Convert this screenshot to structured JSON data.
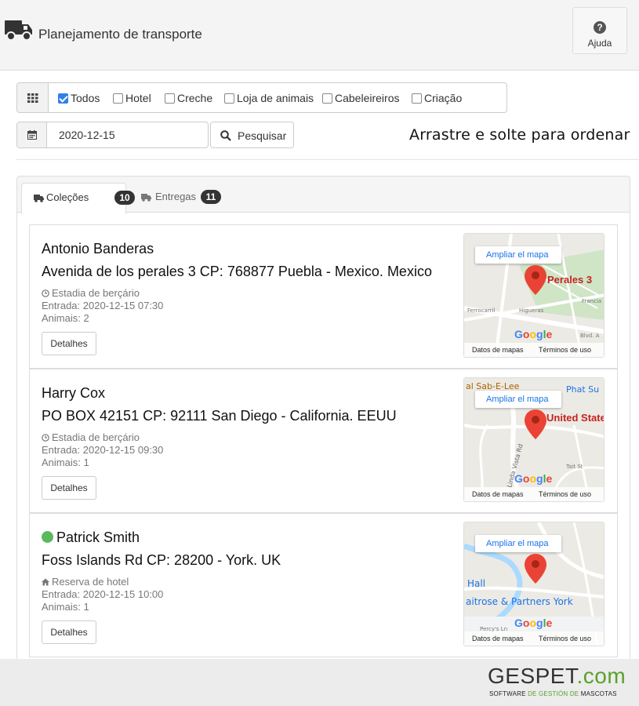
{
  "header": {
    "title": "Planejamento de transporte",
    "help_label": "Ajuda"
  },
  "filters": {
    "options": [
      {
        "label": "Todos",
        "checked": true
      },
      {
        "label": "Hotel",
        "checked": false
      },
      {
        "label": "Creche",
        "checked": false
      },
      {
        "label": "Loja de animais",
        "checked": false
      },
      {
        "label": "Cabeleireiros",
        "checked": false
      },
      {
        "label": "Criação",
        "checked": false
      }
    ],
    "date": "2020-12-15",
    "search_label": "Pesquisar",
    "drag_hint": "Arrastre e solte para ordenar"
  },
  "tabs": [
    {
      "label": "Coleções",
      "count": "10",
      "active": true,
      "icon": "truck-icon"
    },
    {
      "label": "Entregas",
      "count": "11",
      "active": false,
      "icon": "truck-icon"
    }
  ],
  "cards": [
    {
      "name": "Antonio Banderas",
      "address": "Avenida de los perales 3 CP: 768877 Puebla - Mexico. Mexico",
      "service": "Estadia de berçário",
      "service_icon": "clock-icon",
      "entry": "Entrada: 2020-12-15 07:30",
      "animals": "Animais: 2",
      "details_label": "Detalhes",
      "status_dot": false,
      "map": {
        "enlarge": "Ampliar el mapa",
        "place": "Perales 3",
        "labels": [
          "Ferrocarril",
          "Higueras",
          "Francia",
          "Blvd. A"
        ],
        "data": "Datos de mapas",
        "terms": "Términos de uso"
      }
    },
    {
      "name": "Harry Cox",
      "address": "PO BOX 42151 CP: 92111 San Diego - California. EEUU",
      "service": "Estadia de berçário",
      "service_icon": "clock-icon",
      "entry": "Entrada: 2020-12-15 09:30",
      "animals": "Animais: 1",
      "details_label": "Detalhes",
      "status_dot": false,
      "map": {
        "enlarge": "Ampliar el mapa",
        "place": "United States Postal Service",
        "labels": [
          "al Sab-E-Lee",
          "Phat Su",
          "Linda Vista Rd",
          "Tait St"
        ],
        "data": "Datos de mapas",
        "terms": "Términos de uso"
      }
    },
    {
      "name": "Patrick Smith",
      "address": "Foss Islands Rd CP: 28200 - York. UK",
      "service": "Reserva de hotel",
      "service_icon": "home-icon",
      "entry": "Entrada: 2020-12-15 10:00",
      "animals": "Animais: 1",
      "details_label": "Detalhes",
      "status_dot": true,
      "status_color": "#5cb85c",
      "map": {
        "enlarge": "Ampliar el mapa",
        "place": "",
        "labels": [
          "Hall",
          "aitrose & Partners York",
          "Percy's Ln"
        ],
        "data": "Datos de mapas",
        "terms": "Términos de uso"
      }
    }
  ],
  "brand": {
    "name": "GESPET",
    "suffix": ".com",
    "tagline_a": "SOFTWARE ",
    "tagline_b": "DE GESTIÓN DE ",
    "tagline_c": "MASCOTAS"
  },
  "colors": {
    "accent": "#2f80ed",
    "brand_green": "#5aa02c",
    "status_green": "#5cb85c"
  }
}
